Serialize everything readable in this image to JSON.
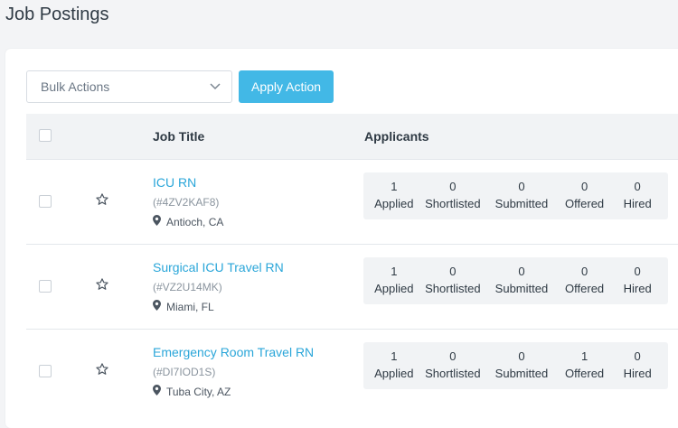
{
  "page": {
    "title": "Job Postings"
  },
  "toolbar": {
    "bulk_actions_label": "Bulk Actions",
    "apply_label": "Apply Action"
  },
  "table": {
    "columns": {
      "job_title": "Job Title",
      "applicants": "Applicants"
    },
    "stat_labels": {
      "applied": "Applied",
      "shortlisted": "Shortlisted",
      "submitted": "Submitted",
      "offered": "Offered",
      "hired": "Hired"
    },
    "rows": [
      {
        "title": "ICU RN",
        "code": "(#4ZV2KAF8)",
        "location": "Antioch, CA",
        "applied": "1",
        "shortlisted": "0",
        "submitted": "0",
        "offered": "0",
        "hired": "0"
      },
      {
        "title": "Surgical ICU Travel RN",
        "code": "(#VZ2U14MK)",
        "location": "Miami, FL",
        "applied": "1",
        "shortlisted": "0",
        "submitted": "0",
        "offered": "0",
        "hired": "0"
      },
      {
        "title": "Emergency Room Travel RN",
        "code": "(#DI7IOD1S)",
        "location": "Tuba City, AZ",
        "applied": "1",
        "shortlisted": "0",
        "submitted": "0",
        "offered": "1",
        "hired": "0"
      }
    ]
  },
  "icons": {
    "dropdown": "chevron-down-icon",
    "star": "star-outline-icon",
    "location": "map-marker-icon"
  },
  "colors": {
    "accent": "#42b8e6",
    "link": "#2aa6d9"
  }
}
